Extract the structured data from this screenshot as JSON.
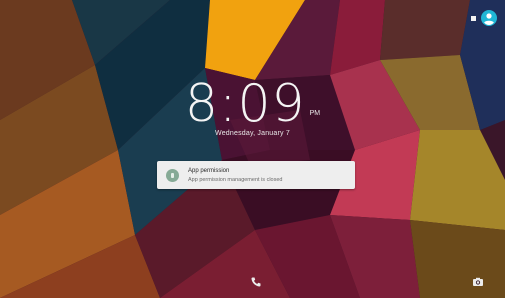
{
  "status_bar": {
    "indicator_icon": "square-icon",
    "user_icon": "account-circle-icon",
    "user_icon_color": "#1fb6d5"
  },
  "clock": {
    "time": "8:09",
    "ampm": "PM"
  },
  "date": "Wednesday, January 7",
  "notification": {
    "icon": "lock-icon",
    "title": "App permission",
    "text": "App permission management is closed"
  },
  "bottom": {
    "left_icon": "phone-icon",
    "right_icon": "camera-icon"
  }
}
